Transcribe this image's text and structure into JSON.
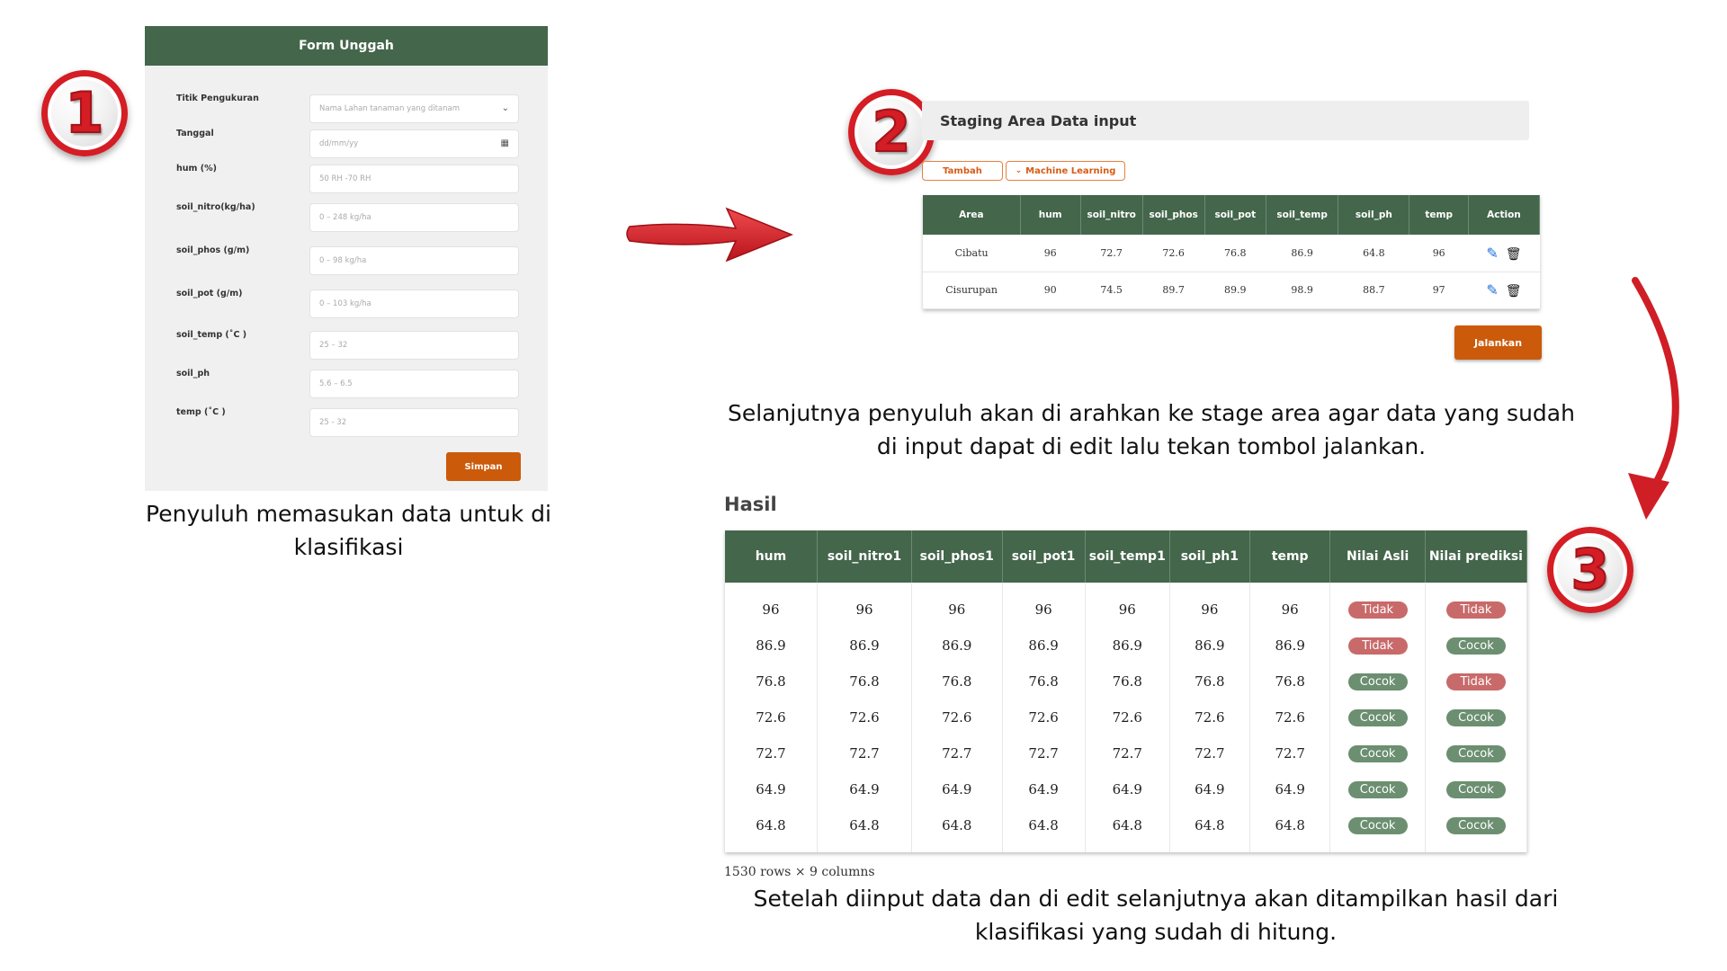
{
  "steps": {
    "one": "1",
    "two": "2",
    "three": "3"
  },
  "form": {
    "title": "Form Unggah",
    "fields": [
      {
        "label": "Titik Pengukuran",
        "placeholder": "Nama Lahan tanaman yang ditanam",
        "icon": "chevron-down-icon"
      },
      {
        "label": "Tanggal",
        "placeholder": "dd/mm/yy",
        "icon": "calendar-icon"
      },
      {
        "label": "hum (%)",
        "placeholder": "50 RH -70 RH"
      },
      {
        "label": "soil_nitro(kg/ha)",
        "placeholder": "0 – 248 kg/ha"
      },
      {
        "label": "soil_phos (g/m)",
        "placeholder": "0 – 98 kg/ha"
      },
      {
        "label": "soil_pot (g/m)",
        "placeholder": "0 – 103 kg/ha"
      },
      {
        "label": "soil_temp (˚C )",
        "placeholder": "25 – 32"
      },
      {
        "label": "soil_ph",
        "placeholder": "5.6 – 6.5"
      },
      {
        "label": "temp (˚C )",
        "placeholder": "25 - 32"
      }
    ],
    "submit_label": "Simpan",
    "caption": "Penyuluh memasukan data untuk di klasifikasi"
  },
  "staging": {
    "title": "Staging Area Data input",
    "add_label": "Tambah",
    "ml_label": "Machine Learning",
    "columns": [
      "Area",
      "hum",
      "soil_nitro",
      "soil_phos",
      "soil_pot",
      "soil_temp",
      "soil_ph",
      "temp",
      "Action"
    ],
    "rows": [
      [
        "Cibatu",
        "96",
        "72.7",
        "72.6",
        "76.8",
        "86.9",
        "64.8",
        "96"
      ],
      [
        "Cisurupan",
        "90",
        "74.5",
        "89.7",
        "89.9",
        "98.9",
        "88.7",
        "97"
      ]
    ],
    "run_label": "Jalankan",
    "caption": "Selanjutnya penyuluh akan di arahkan ke stage area agar data yang sudah di input dapat di edit lalu tekan tombol jalankan."
  },
  "results": {
    "title": "Hasil",
    "columns": [
      "hum",
      "soil_nitro1",
      "soil_phos1",
      "soil_pot1",
      "soil_temp1",
      "soil_ph1",
      "temp",
      "Nilai Asli",
      "Nilai prediksi"
    ],
    "rows": [
      [
        "96",
        "96",
        "96",
        "96",
        "96",
        "96",
        "96",
        "Tidak",
        "Tidak"
      ],
      [
        "86.9",
        "86.9",
        "86.9",
        "86.9",
        "86.9",
        "86.9",
        "86.9",
        "Tidak",
        "Cocok"
      ],
      [
        "76.8",
        "76.8",
        "76.8",
        "76.8",
        "76.8",
        "76.8",
        "76.8",
        "Cocok",
        "Tidak"
      ],
      [
        "72.6",
        "72.6",
        "72.6",
        "72.6",
        "72.6",
        "72.6",
        "72.6",
        "Cocok",
        "Cocok"
      ],
      [
        "72.7",
        "72.7",
        "72.7",
        "72.7",
        "72.7",
        "72.7",
        "72.7",
        "Cocok",
        "Cocok"
      ],
      [
        "64.9",
        "64.9",
        "64.9",
        "64.9",
        "64.9",
        "64.9",
        "64.9",
        "Cocok",
        "Cocok"
      ],
      [
        "64.8",
        "64.8",
        "64.8",
        "64.8",
        "64.8",
        "64.8",
        "64.8",
        "Cocok",
        "Cocok"
      ]
    ],
    "rows_note": "1530 rows × 9 columns",
    "caption": "Setelah diinput data dan di edit selanjutnya akan ditampilkan hasil dari klasifikasi yang sudah di hitung."
  },
  "colors": {
    "header_green": "#44664b",
    "accent_orange": "#cc5a0b",
    "badge_red": "#d41d24",
    "pill_red": "#c96a6a",
    "pill_green": "#6b8f70"
  }
}
